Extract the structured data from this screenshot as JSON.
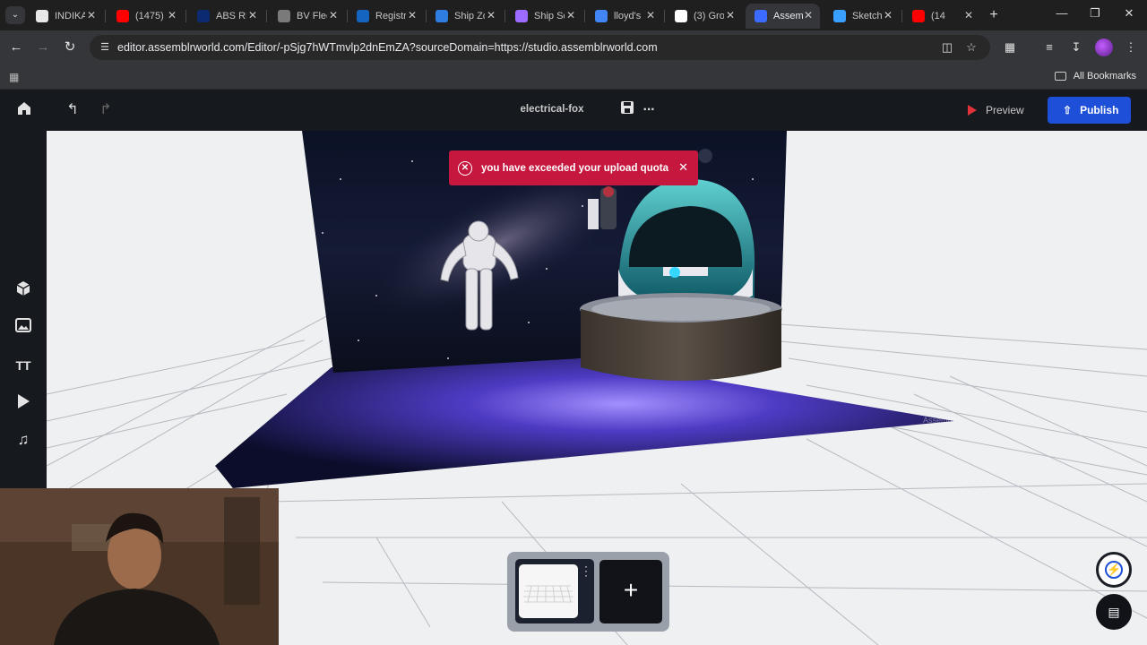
{
  "browser": {
    "tabs": [
      {
        "label": "INDIKA",
        "color": "#e8e8e8"
      },
      {
        "label": "(1475)",
        "color": "#ff0000"
      },
      {
        "label": "ABS RE",
        "color": "#0b2a6f"
      },
      {
        "label": "BV Flee",
        "color": "#7a7a7a"
      },
      {
        "label": "Registr",
        "color": "#1565c0"
      },
      {
        "label": "Ship Zo",
        "color": "#2f7de1"
      },
      {
        "label": "Ship Sc",
        "color": "#9b6cff"
      },
      {
        "label": "lloyd's",
        "color": "#4285f4"
      },
      {
        "label": "(3) Gro",
        "color": "#ffffff"
      },
      {
        "label": "Assem",
        "color": "#3b6bff",
        "active": true
      },
      {
        "label": "Sketch",
        "color": "#3aa0ff"
      },
      {
        "label": "(14",
        "color": "#ff0000"
      }
    ],
    "url": "editor.assemblrworld.com/Editor/-pSjg7hWTmvlp2dnEmZA?sourceDomain=https://studio.assemblrworld.com",
    "all_bookmarks": "All Bookmarks"
  },
  "editor": {
    "project_name": "electrical-fox",
    "preview_label": "Preview",
    "publish_label": "Publish",
    "toast_message": "you have exceeded your upload quota",
    "accent": "#1d4fd8",
    "error_color": "#c6173f"
  },
  "icons": {
    "home": "home-icon",
    "undo": "undo-icon",
    "redo": "redo-icon",
    "save": "save-icon",
    "more": "more-icon",
    "objects": "cube-icon",
    "image": "image-icon",
    "text": "text-icon",
    "media": "play-icon",
    "audio": "music-icon"
  }
}
